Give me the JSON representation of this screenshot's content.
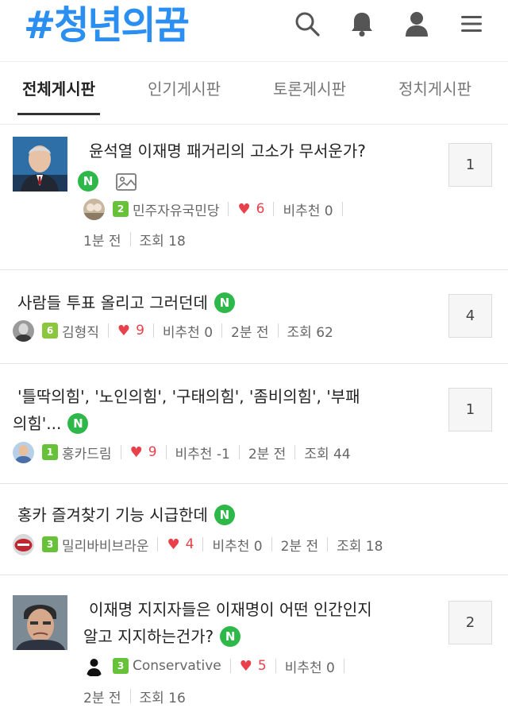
{
  "app": {
    "logo": "#청년의꿈",
    "icons": [
      "search-icon",
      "bell-icon",
      "user-icon",
      "menu-icon"
    ],
    "colors": {
      "brand": "#2a8ff0",
      "new_badge": "#2eb84a",
      "heart": "#e8414b"
    }
  },
  "tabs": [
    {
      "label": "전체게시판",
      "active": true
    },
    {
      "label": "인기게시판",
      "active": false
    },
    {
      "label": "토론게시판",
      "active": false
    },
    {
      "label": "정치게시판",
      "active": false
    }
  ],
  "posts": [
    {
      "title": "윤석열 이재명 패거리의 고소가 무서운가?",
      "title_line2": "",
      "new_badge": "N",
      "has_image": true,
      "level": "2",
      "author": "민주자유국민당",
      "likes": "6",
      "dislike_label": "비추천 0",
      "time": "1분 전",
      "views": "조회 18",
      "comments": "1"
    },
    {
      "title": "사람들 투표 올리고 그러던데",
      "title_line2": "",
      "new_badge": "N",
      "level": "6",
      "author": "김형직",
      "likes": "9",
      "dislike_label": "비추천 0",
      "time": "2분 전",
      "views": "조회 62",
      "comments": "4"
    },
    {
      "title": "'틀딱의힘', '노인의힘', '구태의힘', '좀비의힘', '부패",
      "title_line2": "의힘'...",
      "new_badge": "N",
      "level": "1",
      "author": "홍카드림",
      "likes": "9",
      "dislike_label": "비추천 -1",
      "time": "2분 전",
      "views": "조회 44",
      "comments": "1"
    },
    {
      "title": "홍카 즐겨찾기 기능 시급한데",
      "title_line2": "",
      "new_badge": "N",
      "level": "3",
      "author": "밀리바비브라운",
      "likes": "4",
      "dislike_label": "비추천 0",
      "time": "2분 전",
      "views": "조회 18",
      "comments": ""
    },
    {
      "title": "이재명 지지자들은 이재명이 어떤 인간인지",
      "title_line2": "알고 지지하는건가?",
      "new_badge": "N",
      "level": "3",
      "author": "Conservative",
      "likes": "5",
      "dislike_label": "비추천 0",
      "time": "2분 전",
      "views": "조회 16",
      "comments": "2"
    }
  ]
}
